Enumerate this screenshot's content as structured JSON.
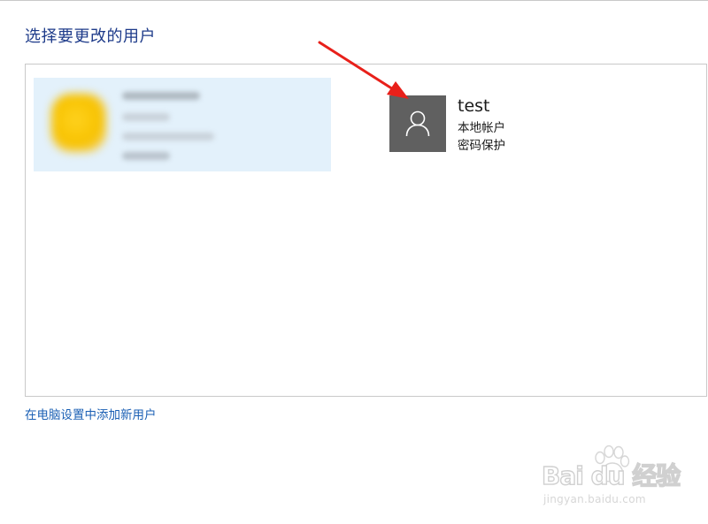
{
  "header": {
    "title": "选择要更改的用户"
  },
  "accounts": [
    {
      "blurred": true
    },
    {
      "name": "test",
      "type": "本地帐户",
      "status": "密码保护",
      "avatar_icon": "user-icon",
      "avatar_color": "#606060"
    }
  ],
  "footer": {
    "add_user_link": "在电脑设置中添加新用户"
  },
  "annotation": {
    "arrow_color": "#e8201a"
  },
  "watermark": {
    "brand": "Bai du 经验",
    "url": "jingyan.baidu.com"
  },
  "colors": {
    "title": "#1e3b8a",
    "link": "#1a5fb4",
    "selected_tile_bg": "#e3f1fb"
  }
}
